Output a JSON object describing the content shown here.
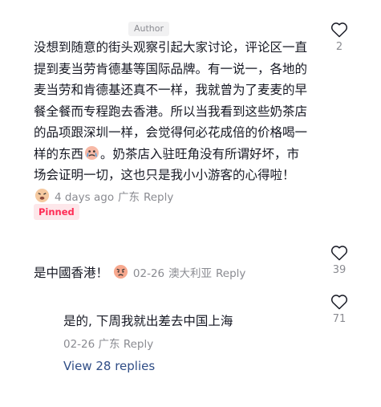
{
  "main_comment": {
    "author_badge": "Author",
    "text_part1": "没想到随意的街头观察引起大家讨论，评论区一直提到麦当劳肯德基等国际品牌。有一说一，各地的麦当劳和肯德基还真不一样，我就曾为了麦麦的早餐全餐而专程跑去香港。所以当我看到这些奶茶店的品项跟深圳一样，会觉得何必花成倍的价格喝一样的东西",
    "text_part2": "。奶茶店入驻旺角没有所谓好坏，市场会证明一切，这也只是我小小游客的心得啦！",
    "time": "4 days ago",
    "location": "广东",
    "reply_label": "Reply",
    "pinned_label": "Pinned",
    "like_count": "2",
    "emojis": [
      "crying-face-emoji",
      "weary-face-emoji"
    ]
  },
  "comment2": {
    "text": "是中國香港！",
    "date": "02-26",
    "location": "澳大利亚",
    "reply_label": "Reply",
    "like_count": "39",
    "emoji": "angry-face-emoji"
  },
  "reply": {
    "text": "是的, 下周我就出差去中国上海",
    "date": "02-26",
    "location": "广东",
    "reply_label": "Reply",
    "like_count": "71"
  },
  "view_replies": "View 28 replies",
  "colors": {
    "text": "#161823",
    "meta": "#8a8b91",
    "pinned": "#fe2c55",
    "link": "#2f4d86"
  }
}
